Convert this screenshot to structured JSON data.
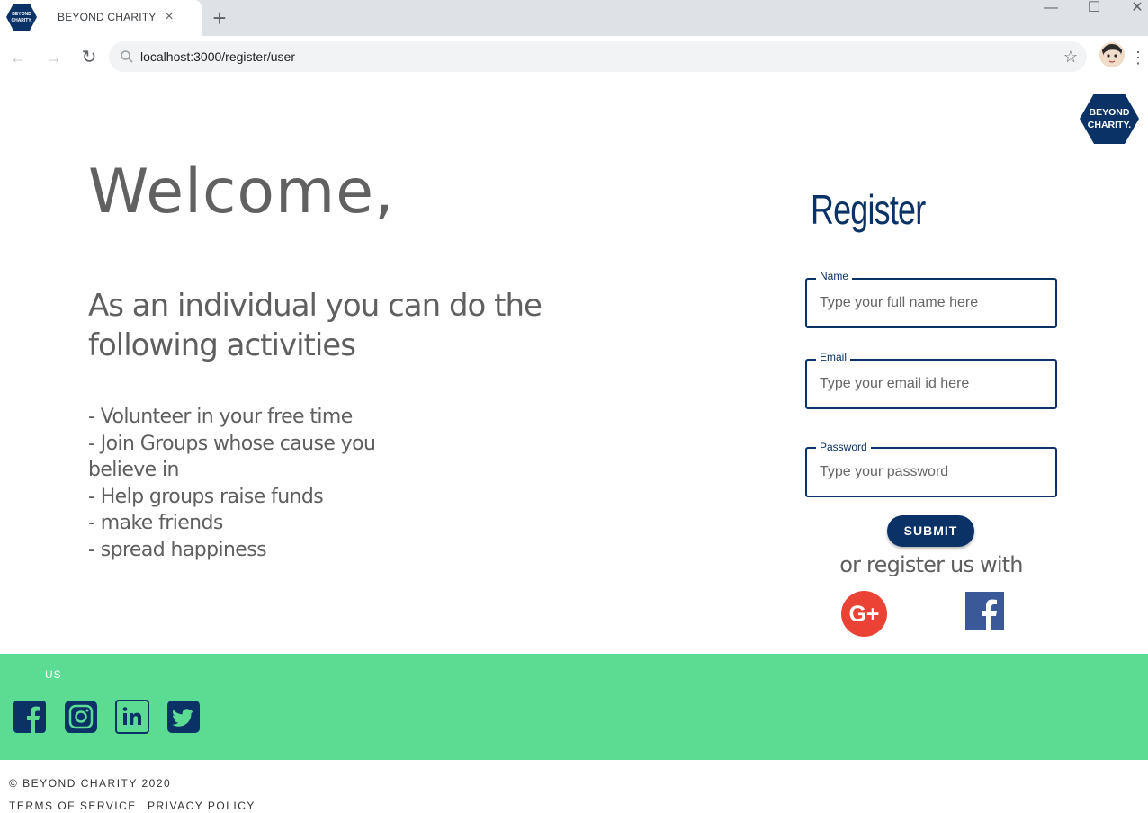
{
  "browser": {
    "tab_title": "BEYOND CHARITY",
    "tab_close": "×",
    "new_tab": "+",
    "url": "localhost:3000/register/user",
    "window_controls": {
      "minimize": "—",
      "maximize": "☐",
      "close": "✕"
    }
  },
  "logo": {
    "line1": "BEYOND",
    "line2": "CHARITY."
  },
  "welcome": {
    "heading": "Welcome,",
    "subtitle": "As an individual you can do the following activities",
    "activities": [
      "- Volunteer in your free time",
      "- Join Groups whose cause you believe in",
      "- Help groups raise funds",
      "- make friends",
      "- spread happiness"
    ]
  },
  "register": {
    "title": "Register",
    "name_label": "Name",
    "name_placeholder": "Type your full name here",
    "email_label": "Email",
    "email_placeholder": "Type your email id here",
    "password_label": "Password",
    "password_placeholder": "Type your password",
    "submit_label": "SUBMIT",
    "or_register": "or register us with"
  },
  "footer": {
    "us_label": "US",
    "copyright": "© BEYOND CHARITY 2020",
    "terms": "TERMS OF SERVICE",
    "privacy": "PRIVACY POLICY"
  },
  "colors": {
    "brand_navy": "#0a3266",
    "footer_green": "#5cdc93",
    "google_red": "#ea4335",
    "facebook_blue": "#3b5998"
  }
}
